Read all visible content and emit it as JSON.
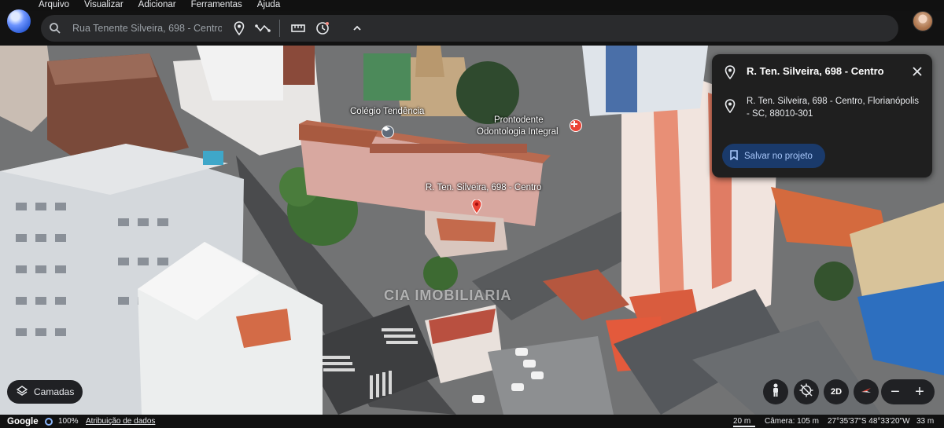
{
  "menu": [
    "Arquivo",
    "Visualizar",
    "Adicionar",
    "Ferramentas",
    "Ajuda"
  ],
  "search": {
    "value": "Rua Tenente Silveira, 698 - Centro",
    "icon": "search-icon"
  },
  "toolbar_icons": [
    "place-marker-icon",
    "path-icon",
    "ruler-icon",
    "history-icon",
    "chevron-up-icon"
  ],
  "map_labels": {
    "school": "Colégio Tendência",
    "dental_line1": "Prontodente",
    "dental_line2": "Odontologia Integral",
    "address_pin": "R. Ten. Silveira, 698 - Centro"
  },
  "watermark": "CIA IMOBILIARIA",
  "panel": {
    "title": "R. Ten. Silveira, 698 - Centro",
    "address": "R. Ten. Silveira, 698 - Centro, Florianópolis - SC, 88010-301",
    "save_label": "Salvar no projeto"
  },
  "layers_label": "Camadas",
  "controls": {
    "twod_label": "2D",
    "zoom_out": "−",
    "zoom_in": "+"
  },
  "status": {
    "brand": "Google",
    "loaded": "100%",
    "attribution": "Atribuição de dados",
    "scale": "20 m",
    "camera": "Câmera: 105 m",
    "coords": "27°35'37\"S 48°33'20\"W",
    "altitude": "33 m"
  },
  "colors": {
    "accent": "#8ab4f8",
    "save_bg": "#1a3a6b",
    "pin": "#ea4335"
  }
}
